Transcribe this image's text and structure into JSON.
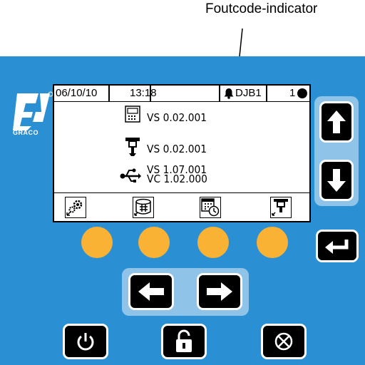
{
  "callout": {
    "label": "Foutcode-indicator"
  },
  "brand": {
    "name": "GRACO",
    "registered": "®"
  },
  "status_bar": {
    "date": "06/10/10",
    "time": "13:18",
    "error_code": "DJB1",
    "unit": "1"
  },
  "versions": {
    "display": "VS 0.02.001",
    "sprayer": "VS 0.02.001",
    "usb_vs": "VS 1.07.001",
    "usb_vc": "VC 1.02.000"
  },
  "icons": {
    "display_module": "display-module-icon",
    "sprayer": "spray-gun-icon",
    "usb": "usb-icon",
    "lock": "lock-icon",
    "alarm": "alarm-bell-icon",
    "status": "status-dot-icon"
  },
  "softkeys": [
    "settings-icon",
    "counter-icon",
    "calendar-clock-icon",
    "gun-icon"
  ],
  "nav_buttons": [
    "up-arrow-icon",
    "down-arrow-icon",
    "enter-icon",
    "left-arrow-icon",
    "right-arrow-icon"
  ],
  "bottom_buttons": [
    "power-icon",
    "unlock-icon",
    "stop-icon"
  ],
  "colors": {
    "panel": "#2b8fd3",
    "softkey_circle": "#f9b233",
    "button": "#000000",
    "frame": "#8fc3e8"
  }
}
